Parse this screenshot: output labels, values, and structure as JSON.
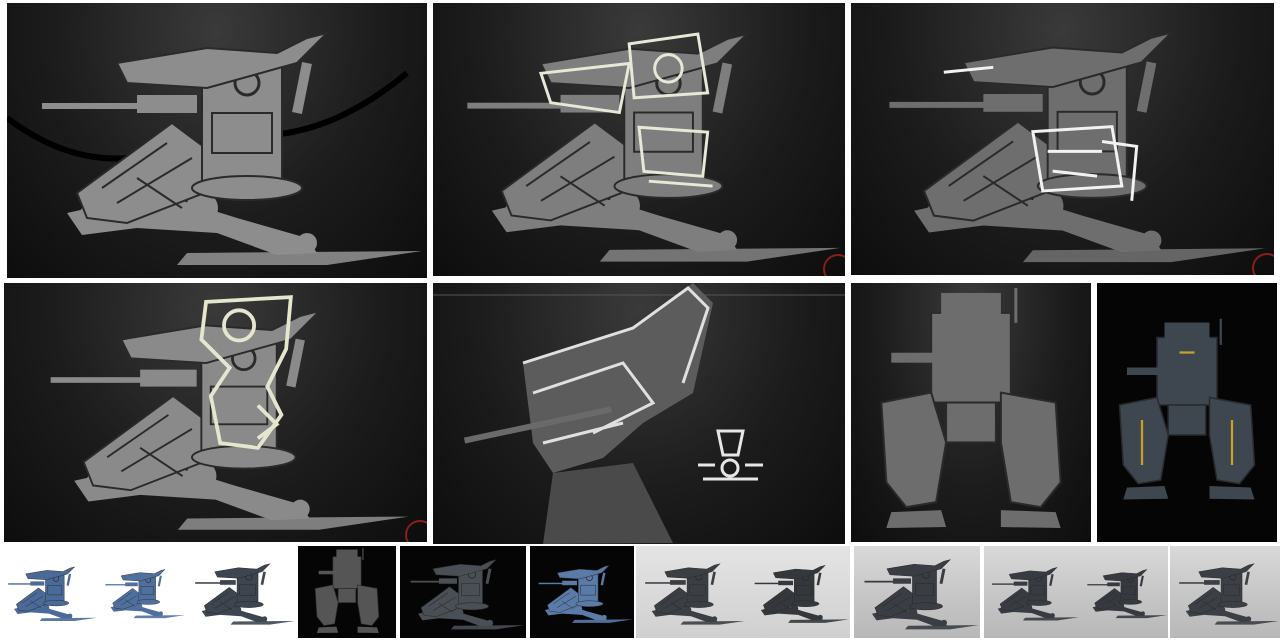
{
  "sheet": {
    "background": "#ffffff",
    "colors": {
      "model_grey": "#8d8d8d",
      "model_dark": "#5a5a5a",
      "sketch_line": "#e8e8d8",
      "render_blue": "#4a6a9a",
      "render_gold": "#c9a02a"
    },
    "rows": [
      {
        "row": "top",
        "tiles": [
          "sculpt-base",
          "sculpt-sketch-overlay",
          "sculpt-detail-overlay"
        ]
      },
      {
        "row": "middle",
        "tiles": [
          "sculpt-side-sketch",
          "sculpt-closeup-sketch",
          "sculpt-front-view",
          "render-front-black"
        ]
      },
      {
        "row": "bottom",
        "tiles": [
          "thumb-blue-1",
          "thumb-blue-2",
          "thumb-dark-1",
          "thumb-black-1",
          "thumb-black-2",
          "thumb-black-blue",
          "thumb-grey-1",
          "thumb-grey-2",
          "thumb-light-1",
          "thumb-light-2",
          "thumb-light-3",
          "thumb-light-4"
        ]
      }
    ]
  }
}
